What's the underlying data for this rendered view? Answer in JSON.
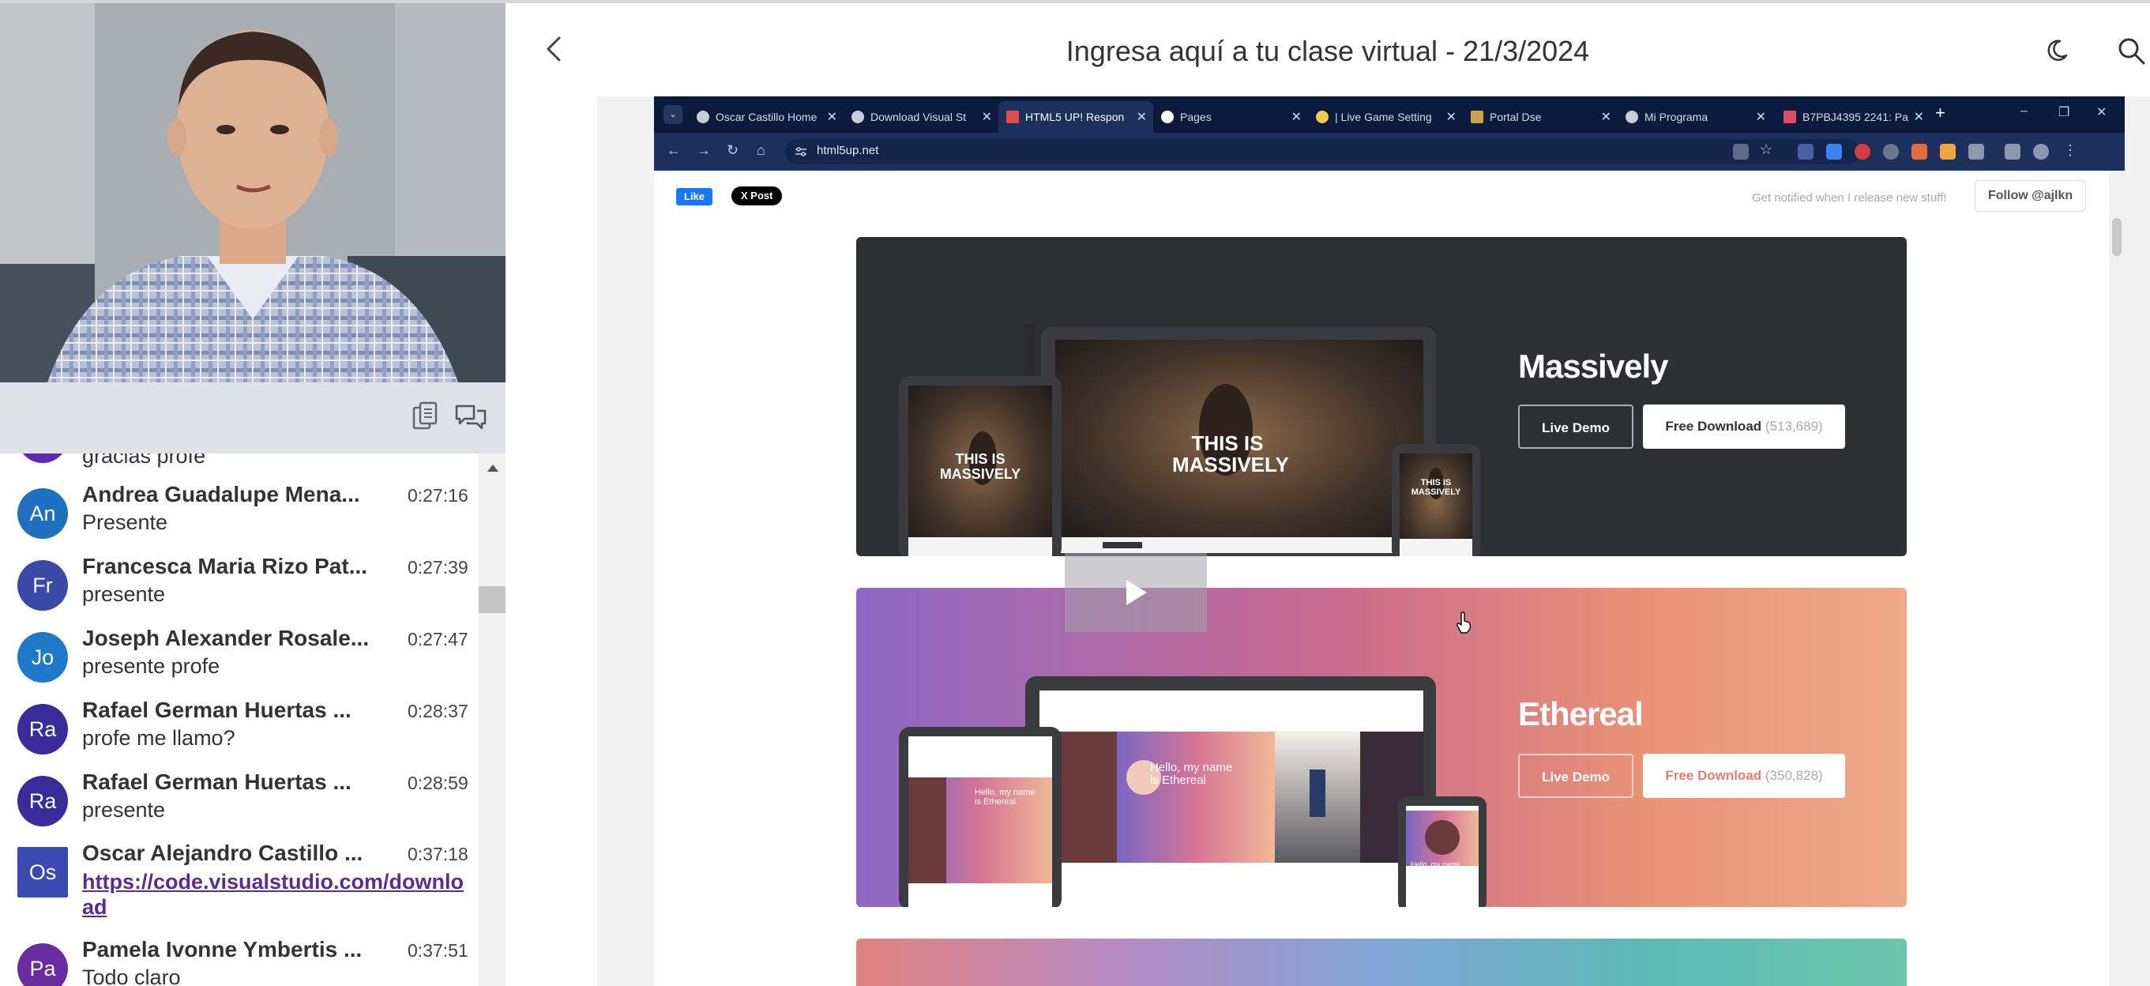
{
  "webcam": {
    "alt": "presenter webcam"
  },
  "chat_toolbar": {
    "copy_icon": "copy-icon",
    "chat_icon": "chat-bubbles-icon"
  },
  "chat": {
    "partial_message": "gracias profe",
    "messages": [
      {
        "initials": "An",
        "name": "Andrea Guadalupe Mena...",
        "time": "0:27:16",
        "text": "Presente",
        "color": "#1f6fbf"
      },
      {
        "initials": "Fr",
        "name": "Francesca Maria Rizo Pat...",
        "time": "0:27:39",
        "text": "presente",
        "color": "#3a4aa8"
      },
      {
        "initials": "Jo",
        "name": "Joseph Alexander Rosale...",
        "time": "0:27:47",
        "text": "presente profe",
        "color": "#1f78c8"
      },
      {
        "initials": "Ra",
        "name": "Rafael German Huertas ...",
        "time": "0:28:37",
        "text": "profe me llamo?",
        "color": "#3a2a9a"
      },
      {
        "initials": "Ra",
        "name": "Rafael German Huertas ...",
        "time": "0:28:59",
        "text": "presente",
        "color": "#3a2a9a"
      },
      {
        "initials": "Os",
        "name": "Oscar Alejandro Castillo ...",
        "time": "0:37:18",
        "link": "https://code.visualstudio.com/download",
        "color": "#3a4ab0"
      },
      {
        "initials": "Pa",
        "name": "Pamela Ivonne Ymbertis ...",
        "time": "0:37:51",
        "text": "Todo claro",
        "color": "#6a2aa0"
      }
    ]
  },
  "header": {
    "title": "Ingresa aquí a tu clase virtual - 21/3/2024",
    "back_icon": "chevron-left-icon",
    "theme_icon": "moon-icon",
    "search_icon": "search-icon"
  },
  "browser": {
    "tabs": [
      {
        "label": "Oscar Castillo Home"
      },
      {
        "label": "Download Visual St"
      },
      {
        "label": "HTML5 UP! Respon",
        "active": true
      },
      {
        "label": "Pages"
      },
      {
        "label": "| Live Game Setting"
      },
      {
        "label": "Portal Dse"
      },
      {
        "label": "Mi Programa"
      },
      {
        "label": "B7PBJ4395 2241: Pa"
      }
    ],
    "new_tab": "+",
    "url": "html5up.net",
    "window_controls": [
      "–",
      "❐",
      "✕"
    ]
  },
  "page": {
    "fb_like": "Like",
    "x_post": "X Post",
    "notify_text": "Get notified when I release new stuff!",
    "follow_label": "Follow @ajlkn",
    "templates": [
      {
        "name": "Massively",
        "demo_label": "Live Demo",
        "download_label": "Free Download",
        "download_count": "(513,689)",
        "mock_heading_1": "THIS IS",
        "mock_heading_2": "MASSIVELY"
      },
      {
        "name": "Ethereal",
        "demo_label": "Live Demo",
        "download_label": "Free Download",
        "download_count": "(350,828)",
        "mock_heading": "Hello, my name is Ethereal",
        "mock_heading_line1": "Hello, my name",
        "mock_heading_line2": "is Ethereal"
      }
    ]
  },
  "video": {
    "play_icon": "play-icon"
  },
  "colors": {
    "browser_tabbar": "#0b1a3d",
    "browser_toolbar": "#1d2f5c",
    "chat_toolbar": "#dfe3e7"
  }
}
